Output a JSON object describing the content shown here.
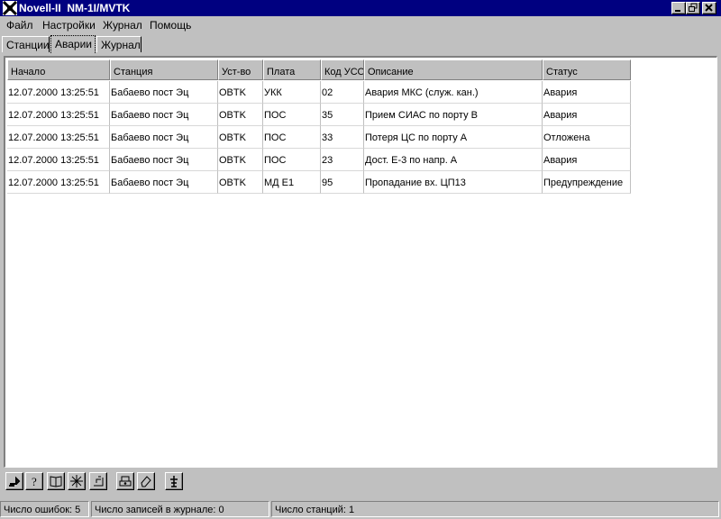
{
  "window": {
    "title": "Novell-II  NM-1I/MVTK"
  },
  "menu": [
    "Файл",
    "Настройки",
    "Журнал",
    "Помощь"
  ],
  "tabs": [
    {
      "label": "Станции",
      "active": false
    },
    {
      "label": "Аварии",
      "active": true
    },
    {
      "label": "Журнал",
      "active": false
    }
  ],
  "table": {
    "columns": [
      "Начало",
      "Станция",
      "Уст-во",
      "Плата",
      "Код УСО",
      "Описание",
      "Статус"
    ],
    "rows": [
      [
        "12.07.2000 13:25:51",
        "Бабаево пост Эц",
        "OBTK",
        "УКК",
        "02",
        "Авария МКС (служ. кан.)",
        "Авария"
      ],
      [
        "12.07.2000 13:25:51",
        "Бабаево пост Эц",
        "OBTK",
        "ПОС",
        "35",
        "Прием СИАС по порту B",
        "Авария"
      ],
      [
        "12.07.2000 13:25:51",
        "Бабаево пост Эц",
        "OBTK",
        "ПОС",
        "33",
        "Потеря ЦС по порту A",
        "Отложена"
      ],
      [
        "12.07.2000 13:25:51",
        "Бабаево пост Эц",
        "OBTK",
        "ПОС",
        "23",
        "Дост. Е-3 по напр. А",
        "Авария"
      ],
      [
        "12.07.2000 13:25:51",
        "Бабаево пост Эц",
        "OBTK",
        "МД Е1",
        "95",
        "Пропадание вх. ЦП13",
        "Предупреждение"
      ]
    ]
  },
  "toolbar": [
    {
      "icon": "exit-icon"
    },
    {
      "icon": "help-icon"
    },
    {
      "icon": "book-icon"
    },
    {
      "icon": "network-icon"
    },
    {
      "icon": "settings-icon"
    },
    {
      "icon": "print-icon"
    },
    {
      "icon": "clear-icon"
    },
    {
      "icon": "antenna-icon"
    }
  ],
  "status": {
    "errors": "Число ошибок: 5",
    "journal_records": "Число записей в журнале: 0",
    "stations": "Число станций: 1"
  }
}
